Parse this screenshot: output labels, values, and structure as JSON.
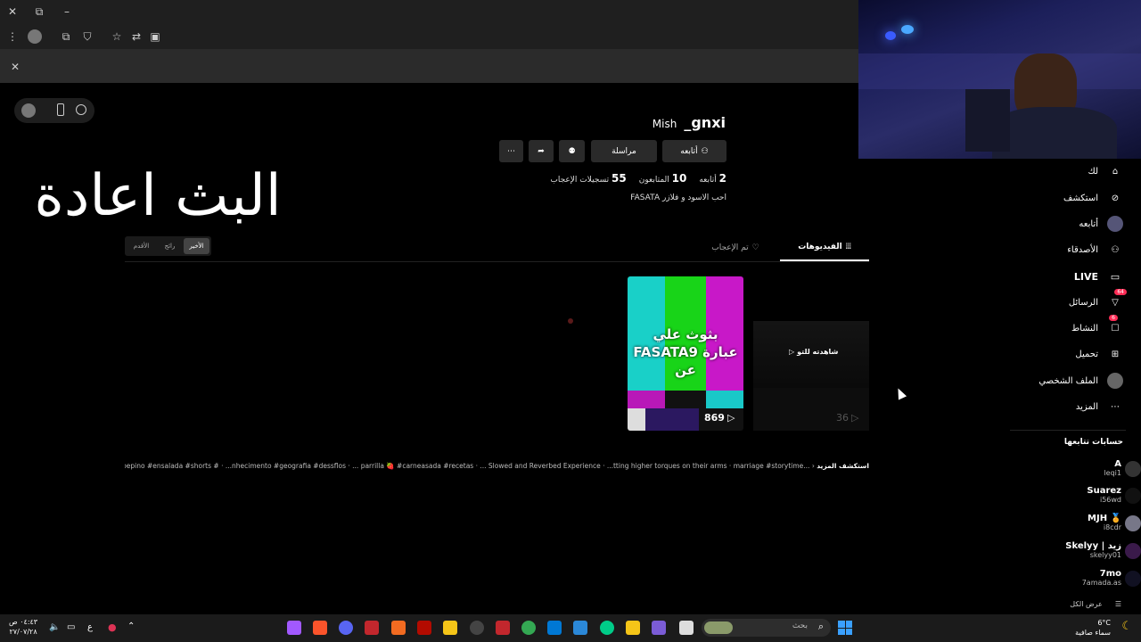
{
  "window": {
    "close": "✕",
    "restore": "⧉",
    "minimize": "–"
  },
  "notice": {
    "close": "✕"
  },
  "overlay_text": "البث اعادة",
  "profile": {
    "display_name": "gnxi_",
    "username": "Mish",
    "buttons": {
      "follow": "أتابعه",
      "message": "مراسلة"
    },
    "stats": [
      {
        "value": "2",
        "label": "أتابعه"
      },
      {
        "value": "10",
        "label": "المتابعون"
      },
      {
        "value": "55",
        "label": "تسجيلات الإعجاب"
      }
    ],
    "bio": "احب الاسود و فلازر FASATA"
  },
  "tabs": {
    "videos": "الفيديوهات",
    "liked": "تم الإعجاب"
  },
  "sort": [
    "الأخير",
    "رائج",
    "الأقدم"
  ],
  "video1": {
    "overlay": "بثوث علي FASATA9 عبارة عن",
    "views": "869"
  },
  "video2": {
    "watched": "شاهدته للتو",
    "views": "36"
  },
  "ticker": {
    "label": "استكشف المزيد",
    "items": [
      "...pepino #ensalada #shorts #",
      "...nhecimento #geografia #dessflos",
      "... parrilla 🍓 #carneasada #recetas",
      "... Slowed and Reverbed Experience",
      "...tting higher torques on their arms",
      "marriage #storytime"
    ]
  },
  "sidebar": {
    "items": [
      {
        "label": "لك",
        "icon": "home-icon"
      },
      {
        "label": "استكشف",
        "icon": "compass-icon"
      },
      {
        "label": "أتابعه",
        "icon": "following-avatar-icon"
      },
      {
        "label": "الأصدقاء",
        "icon": "friends-icon"
      },
      {
        "label": "LIVE",
        "icon": "live-icon"
      },
      {
        "label": "الرسائل",
        "icon": "messages-icon",
        "badge": "64"
      },
      {
        "label": "النشاط",
        "icon": "activity-icon",
        "badge": "6"
      },
      {
        "label": "تحميل",
        "icon": "upload-icon"
      },
      {
        "label": "الملف الشخصي",
        "icon": "profile-icon"
      },
      {
        "label": "المزيد",
        "icon": "more-icon"
      }
    ],
    "following_title": "حسابات تتابعها",
    "following": [
      {
        "name": "A",
        "handle": "leqi1"
      },
      {
        "name": "Suarez",
        "handle": "i56wd"
      },
      {
        "name": "MJH 🏅",
        "handle": "i8cdr"
      },
      {
        "name": "Skelyy | زيد",
        "handle": "skelyy01"
      },
      {
        "name": "7mo",
        "handle": "7amada.as"
      }
    ],
    "see_all": "عرض الكل"
  },
  "taskbar": {
    "search_placeholder": "بحث",
    "time": "٠٤:٤٣ ص",
    "date": "٢٧/٠٧/٢٨",
    "lang": "ع",
    "weather_temp": "6°C",
    "weather_desc": "سماء صافية"
  }
}
